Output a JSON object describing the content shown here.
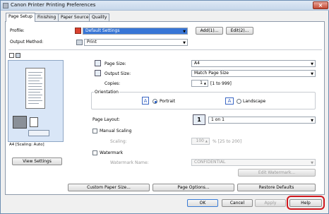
{
  "window": {
    "title": "Canon Printer Printing Preferences",
    "close_glyph": "×"
  },
  "tabs": [
    {
      "label": "Page Setup"
    },
    {
      "label": "Finishing"
    },
    {
      "label": "Paper Source"
    },
    {
      "label": "Quality"
    }
  ],
  "profile": {
    "label": "Profile:",
    "value": "Default Settings",
    "add_label": "Add(1)...",
    "edit_label": "Edit(2)..."
  },
  "output_method": {
    "label": "Output Method:",
    "value": "Print"
  },
  "preview": {
    "caption": "A4 [Scaling: Auto]",
    "view_settings_label": "View Settings"
  },
  "page_size": {
    "label": "Page Size:",
    "value": "A4"
  },
  "output_size": {
    "label": "Output Size:",
    "value": "Match Page Size"
  },
  "copies": {
    "label": "Copies:",
    "value": "1",
    "range": "[1 to 999]"
  },
  "orientation": {
    "label": "Orientation",
    "portrait_label": "Portrait",
    "landscape_label": "Landscape",
    "selected": "Portrait"
  },
  "page_layout": {
    "label": "Page Layout:",
    "value": "1 on 1",
    "icon_glyph": "1"
  },
  "manual_scaling": {
    "label": "Manual Scaling",
    "scaling_label": "Scaling:",
    "scaling_value": "100",
    "scaling_range": "% [25 to 200]"
  },
  "watermark": {
    "label": "Watermark",
    "name_label": "Watermark Name:",
    "name_value": "CONFIDENTIAL",
    "edit_label": "Edit Watermark..."
  },
  "bottom_buttons": {
    "custom_paper_size": "Custom Paper Size...",
    "page_options": "Page Options...",
    "restore_defaults": "Restore Defaults"
  },
  "dialog_buttons": {
    "ok": "OK",
    "cancel": "Cancel",
    "apply": "Apply",
    "help": "Help"
  },
  "colors": {
    "highlight": "#d0161c",
    "selection": "#3876d6"
  }
}
